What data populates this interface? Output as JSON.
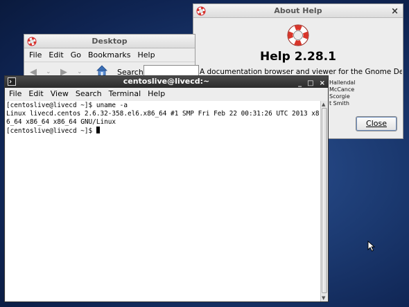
{
  "about_help": {
    "title": "About Help",
    "close_glyph": "×",
    "app_name": "Help 2.28.1",
    "description": "A documentation browser and viewer for the Gnome Desktop.",
    "credits": [
      "Hallendal",
      "McCance",
      "Scorgie",
      "t Smith"
    ],
    "close_button": "Close"
  },
  "desktop_window": {
    "title": "Desktop",
    "menu": [
      "File",
      "Edit",
      "Go",
      "Bookmarks",
      "Help"
    ],
    "search_label": "Search:",
    "search_value": ""
  },
  "terminal": {
    "title": "centoslive@livecd:~",
    "controls": [
      "_",
      "□",
      "×"
    ],
    "menu": [
      "File",
      "Edit",
      "View",
      "Search",
      "Terminal",
      "Help"
    ],
    "lines": [
      "[centoslive@livecd ~]$ uname -a",
      "Linux livecd.centos 2.6.32-358.el6.x86_64 #1 SMP Fri Feb 22 00:31:26 UTC 2013 x8",
      "6_64 x86_64 x86_64 GNU/Linux",
      "[centoslive@livecd ~]$ "
    ]
  },
  "icons": {
    "window_menu": "help-lifebuoy-icon",
    "about_logo": "lifebuoy-icon",
    "home": "home-icon",
    "terminal_menu": "terminal-icon",
    "pointer": "mouse-pointer-icon"
  },
  "colors": {
    "desktop_bg": "#1b3970",
    "active_titlebar": "#2a2a2a",
    "lifebuoy_red": "#d9362b"
  }
}
